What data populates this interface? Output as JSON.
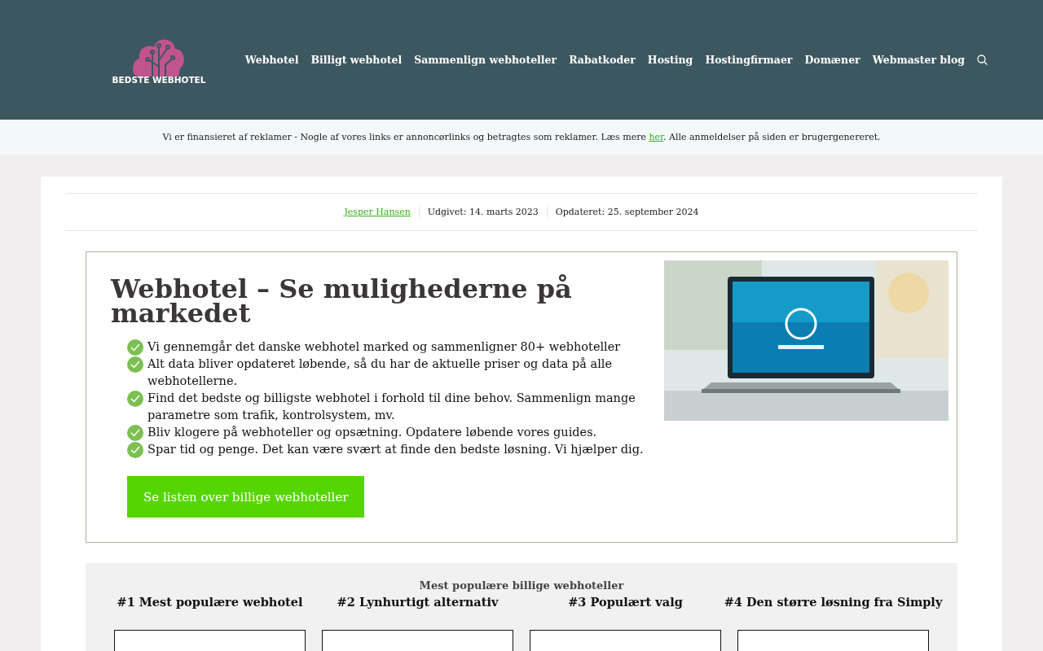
{
  "header": {
    "logo_text": "BEDSTE WEBHOTEL",
    "nav": [
      {
        "label": "Webhotel"
      },
      {
        "label": "Billigt webhotel"
      },
      {
        "label": "Sammenlign webhoteller"
      },
      {
        "label": "Rabatkoder"
      },
      {
        "label": "Hosting"
      },
      {
        "label": "Hostingfirmaer"
      },
      {
        "label": "Domæner"
      },
      {
        "label": "Webmaster blog"
      }
    ]
  },
  "notice": {
    "before": "Vi er finansieret af reklamer - Nogle af vores links er annoncørlinks og betragtes som reklamer. Læs mere ",
    "link": "her",
    "after": ". Alle anmeldelser på siden er brugergenereret."
  },
  "meta": {
    "author": "Jesper Hansen",
    "published": "Udgivet: 14. marts 2023",
    "updated": "Opdateret: 25. september 2024"
  },
  "hero": {
    "title": "Webhotel – Se mulighederne på markedet",
    "bullets": [
      "Vi gennemgår det danske webhotel marked og sammenligner 80+ webhoteller",
      "Alt data bliver opdateret løbende, så du har de aktuelle priser og data på alle webhotellerne.",
      "Find det bedste og billigste webhotel i forhold til dine behov. Sammenlign mange parametre som trafik, kontrolsystem, mv.",
      "Bliv klogere på webhoteller og opsætning. Opdatere løbende vores guides.",
      "Spar tid og penge. Det kan være svært at finde den bedste løsning. Vi hjælper dig."
    ],
    "button": "Se listen over billige webhoteller"
  },
  "popular": {
    "title": "Mest populære billige webhoteller",
    "columns": [
      {
        "heading": "#1 Mest populære webhotel"
      },
      {
        "heading": "#2 Lynhurtigt alternativ"
      },
      {
        "heading": "#3 Populært valg"
      },
      {
        "heading": "#4 Den større løsning fra Simply"
      }
    ]
  }
}
